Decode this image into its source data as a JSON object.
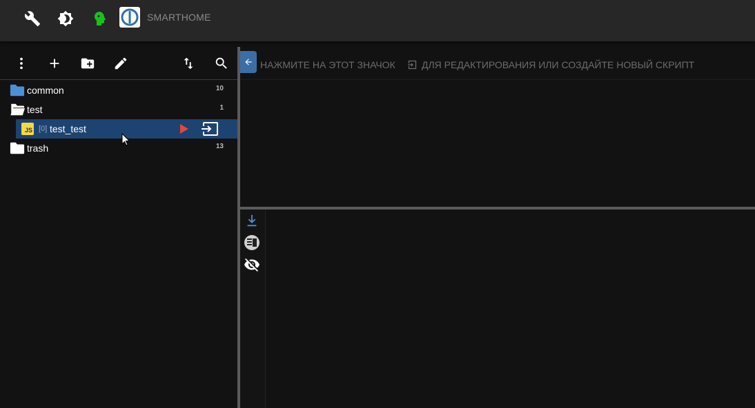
{
  "header": {
    "app_name": "SMARTHOME",
    "icons": [
      "wrench-icon",
      "brightness-icon",
      "head-icon",
      "logo"
    ],
    "colors": {
      "head_icon": "#17c317",
      "logo_blue": "#2f6fb0"
    }
  },
  "left_toolbar": {
    "buttons": [
      "more-vert-icon",
      "add-icon",
      "create-folder-icon",
      "edit-icon",
      "sort-icon",
      "search-icon"
    ]
  },
  "tree": {
    "folders": [
      {
        "name": "common",
        "count": "10",
        "state": "closed",
        "color": "#4a90d9"
      },
      {
        "name": "test",
        "count": "1",
        "state": "open",
        "color": "#ffffff"
      },
      {
        "name": "trash",
        "count": "13",
        "state": "closed",
        "color": "#ffffff"
      }
    ],
    "script": {
      "badge": "JS",
      "index": "[0]",
      "name": "test_test",
      "selected": true
    }
  },
  "hint": {
    "part1": "НАЖМИТЕ НА ЭТОТ ЗНАЧОК",
    "part2": "ДЛЯ РЕДАКТИРОВАНИЯ ИЛИ СОЗДАЙТЕ НОВЫЙ СКРИПТ"
  },
  "log_toolbar": {
    "buttons": [
      "scroll-down-icon",
      "log-layout-icon",
      "hide-icon"
    ]
  },
  "colors": {
    "accent": "#3b6ea5",
    "selected_row": "#1d4370",
    "play": "#e8453c",
    "js_badge": "#f0d94a"
  }
}
